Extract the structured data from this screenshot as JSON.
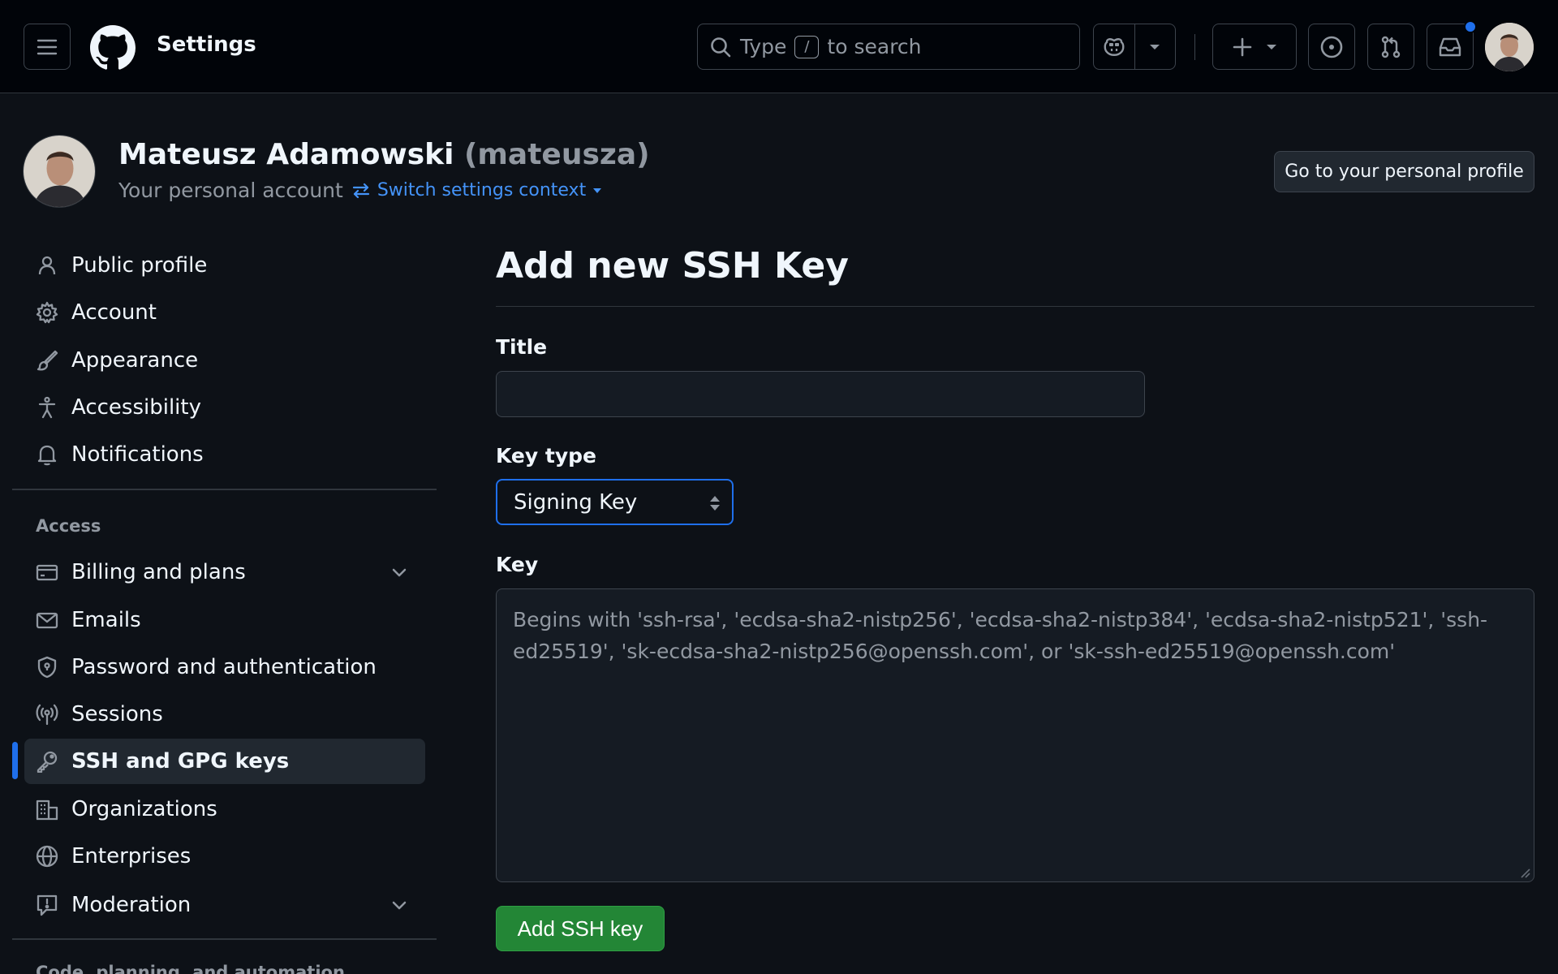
{
  "header": {
    "title": "Settings",
    "search_prefix": "Type",
    "search_key": "/",
    "search_suffix": "to search"
  },
  "account": {
    "display_name": "Mateusz Adamowski",
    "login": "(mateusza)",
    "subtitle": "Your personal account",
    "switch_context": "Switch settings context",
    "profile_button": "Go to your personal profile"
  },
  "sidebar": {
    "items_top": [
      {
        "label": "Public profile",
        "icon": "person-icon"
      },
      {
        "label": "Account",
        "icon": "gear-icon"
      },
      {
        "label": "Appearance",
        "icon": "paintbrush-icon"
      },
      {
        "label": "Accessibility",
        "icon": "accessibility-icon"
      },
      {
        "label": "Notifications",
        "icon": "bell-icon"
      }
    ],
    "access_heading": "Access",
    "access_items": [
      {
        "label": "Billing and plans",
        "icon": "credit-card-icon",
        "expandable": true
      },
      {
        "label": "Emails",
        "icon": "mail-icon"
      },
      {
        "label": "Password and authentication",
        "icon": "shield-lock-icon"
      },
      {
        "label": "Sessions",
        "icon": "broadcast-icon"
      },
      {
        "label": "SSH and GPG keys",
        "icon": "key-icon",
        "active": true
      },
      {
        "label": "Organizations",
        "icon": "organization-icon"
      },
      {
        "label": "Enterprises",
        "icon": "globe-icon"
      },
      {
        "label": "Moderation",
        "icon": "report-icon",
        "expandable": true
      }
    ],
    "next_heading": "Code, planning, and automation"
  },
  "form": {
    "page_title": "Add new SSH Key",
    "title_label": "Title",
    "title_value": "",
    "key_type_label": "Key type",
    "key_type_selected": "Signing Key",
    "key_label": "Key",
    "key_placeholder": "Begins with 'ssh-rsa', 'ecdsa-sha2-nistp256', 'ecdsa-sha2-nistp384', 'ecdsa-sha2-nistp521', 'ssh-ed25519', 'sk-ecdsa-sha2-nistp256@openssh.com', or 'sk-ssh-ed25519@openssh.com'",
    "submit_label": "Add SSH key"
  },
  "colors": {
    "accent": "#1f6feb",
    "link": "#4493f8",
    "primary_button": "#238636",
    "background": "#0d1117",
    "header_background": "#010409"
  }
}
